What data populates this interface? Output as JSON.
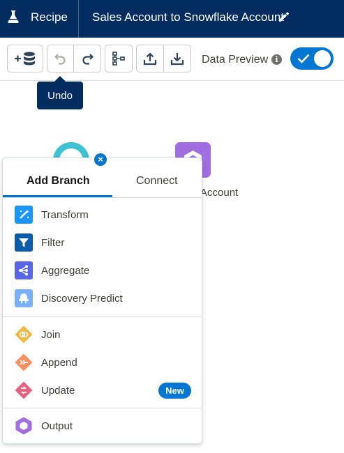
{
  "header": {
    "app_label": "Recipe",
    "title": "Sales Account to Snowflake Account",
    "icons": {
      "app": "flask-icon",
      "edit": "pencil-icon"
    },
    "background_color": "#032d60"
  },
  "toolbar": {
    "buttons": [
      {
        "name": "add-data-button",
        "icon": "add-database-icon"
      },
      {
        "name": "undo-button",
        "icon": "undo-icon",
        "disabled": true
      },
      {
        "name": "redo-button",
        "icon": "redo-icon"
      },
      {
        "name": "auto-layout-button",
        "icon": "hierarchy-icon"
      },
      {
        "name": "upload-button",
        "icon": "upload-icon"
      },
      {
        "name": "download-button",
        "icon": "download-icon"
      }
    ],
    "data_preview_label": "Data Preview",
    "data_preview_on": true,
    "info_glyph": "i"
  },
  "tooltip": {
    "text": "Undo"
  },
  "canvas": {
    "node_right_label": "Account",
    "close_glyph": "×"
  },
  "popover": {
    "tabs": [
      {
        "label": "Add Branch",
        "active": true
      },
      {
        "label": "Connect",
        "active": false
      }
    ],
    "groups": [
      [
        {
          "label": "Transform",
          "icon": "transform-icon",
          "color": "#1b96ff"
        },
        {
          "label": "Filter",
          "icon": "filter-icon",
          "color": "#0b5cab"
        },
        {
          "label": "Aggregate",
          "icon": "aggregate-icon",
          "color": "#5867e8"
        },
        {
          "label": "Discovery Predict",
          "icon": "discovery-predict-icon",
          "color": "#78b0fd"
        }
      ],
      [
        {
          "label": "Join",
          "icon": "join-icon",
          "color": "#f4b63e"
        },
        {
          "label": "Append",
          "icon": "append-icon",
          "color": "#fe8f60"
        },
        {
          "label": "Update",
          "icon": "update-icon",
          "color": "#e8617f",
          "badge": "New"
        }
      ],
      [
        {
          "label": "Output",
          "icon": "output-icon",
          "color": "#a06ee1"
        }
      ]
    ]
  },
  "colors": {
    "accent": "#0176d3",
    "navy": "#032d60"
  }
}
